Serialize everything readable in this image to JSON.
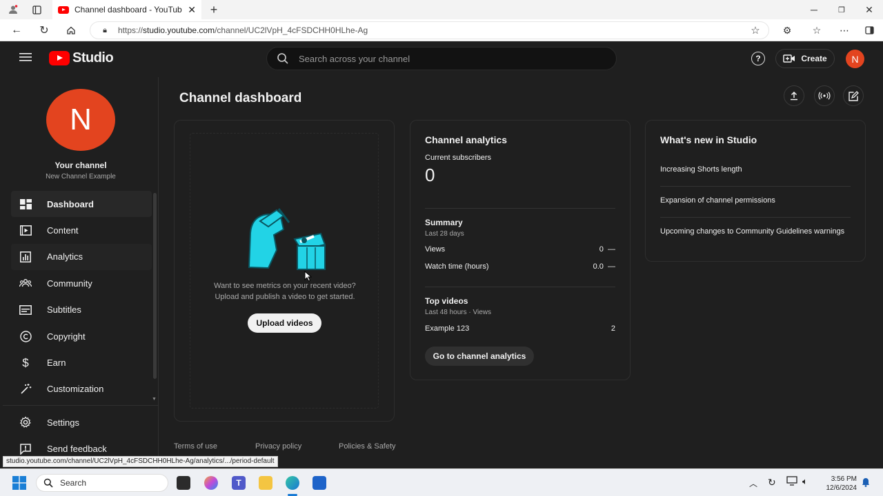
{
  "browser": {
    "tab_title": "Channel dashboard - YouTube Stu",
    "url_prefix": "https://",
    "url_host": "studio.youtube.com",
    "url_path": "/channel/UC2lVpH_4cFSDCHH0HLhe-Ag",
    "status_url": "studio.youtube.com/channel/UC2lVpH_4cFSDCHH0HLhe-Ag/analytics/.../period-default"
  },
  "header": {
    "logo_text": "Studio",
    "search_placeholder": "Search across your channel",
    "create_label": "Create",
    "avatar_letter": "N"
  },
  "sidebar": {
    "avatar_letter": "N",
    "channel_title": "Your channel",
    "channel_name": "New Channel Example",
    "items": [
      {
        "label": "Dashboard",
        "icon": "dashboard-icon"
      },
      {
        "label": "Content",
        "icon": "content-icon"
      },
      {
        "label": "Analytics",
        "icon": "analytics-icon"
      },
      {
        "label": "Community",
        "icon": "community-icon"
      },
      {
        "label": "Subtitles",
        "icon": "subtitles-icon"
      },
      {
        "label": "Copyright",
        "icon": "copyright-icon"
      },
      {
        "label": "Earn",
        "icon": "earn-icon"
      },
      {
        "label": "Customization",
        "icon": "customization-icon"
      }
    ],
    "bottom_items": [
      {
        "label": "Settings",
        "icon": "gear-icon"
      },
      {
        "label": "Send feedback",
        "icon": "feedback-icon"
      }
    ]
  },
  "main": {
    "title": "Channel dashboard",
    "upload_card": {
      "line1": "Want to see metrics on your recent video?",
      "line2": "Upload and publish a video to get started.",
      "button": "Upload videos"
    },
    "analytics": {
      "title": "Channel analytics",
      "subscribers_label": "Current subscribers",
      "subscribers_value": "0",
      "summary_title": "Summary",
      "summary_period": "Last 28 days",
      "views_label": "Views",
      "views_value": "0",
      "watch_label": "Watch time (hours)",
      "watch_value": "0.0",
      "trend": "—",
      "top_videos_title": "Top videos",
      "top_videos_sub": "Last 48 hours · Views",
      "video_title": "Example 123",
      "video_views": "2",
      "button": "Go to channel analytics"
    },
    "whats_new": {
      "title": "What's new in Studio",
      "items": [
        "Increasing Shorts length",
        "Expansion of channel permissions",
        "Upcoming changes to Community Guidelines warnings"
      ]
    },
    "footer": {
      "terms": "Terms of use",
      "privacy": "Privacy policy",
      "policies": "Policies & Safety"
    }
  },
  "taskbar": {
    "search_label": "Search",
    "time": "3:56 PM",
    "date": "12/6/2024"
  },
  "colors": {
    "brand_red": "#ff0000",
    "avatar_orange": "#e3441f",
    "illustration_cyan": "#22d3e6"
  }
}
